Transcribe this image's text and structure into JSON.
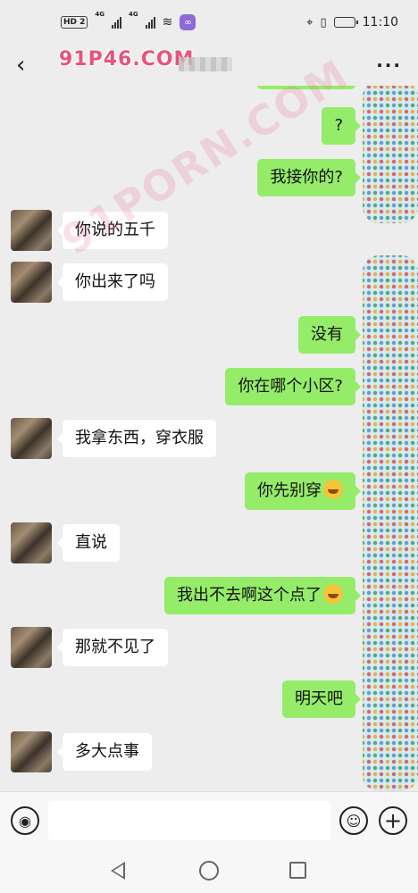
{
  "status_bar": {
    "hd_label": "HD 2",
    "net_label_1": "4G",
    "net_label_2": "4G",
    "time": "11:10",
    "battery_level": 0.85
  },
  "header": {
    "title": "91P46.COM"
  },
  "watermark": "91PORN.COM",
  "messages": [
    {
      "side": "out",
      "text": "?"
    },
    {
      "side": "out",
      "text": "我接你的?"
    },
    {
      "side": "in",
      "text": "你说的五千"
    },
    {
      "side": "in",
      "text": "你出来了吗"
    },
    {
      "side": "out",
      "text": "没有"
    },
    {
      "side": "out",
      "text": "你在哪个小区?"
    },
    {
      "side": "in",
      "text": "我拿东西，穿衣服"
    },
    {
      "side": "out",
      "text": "你先别穿",
      "emoji": "laughing-tears"
    },
    {
      "side": "in",
      "text": "直说"
    },
    {
      "side": "out",
      "text": "我出不去啊这个点了",
      "emoji": "crying"
    },
    {
      "side": "in",
      "text": "那就不见了"
    },
    {
      "side": "out",
      "text": "明天吧"
    },
    {
      "side": "in",
      "text": "多大点事"
    }
  ],
  "colors": {
    "outgoing_bubble": "#95ec69",
    "incoming_bubble": "#ffffff",
    "background": "#ededed",
    "watermark": "#e7537a"
  }
}
